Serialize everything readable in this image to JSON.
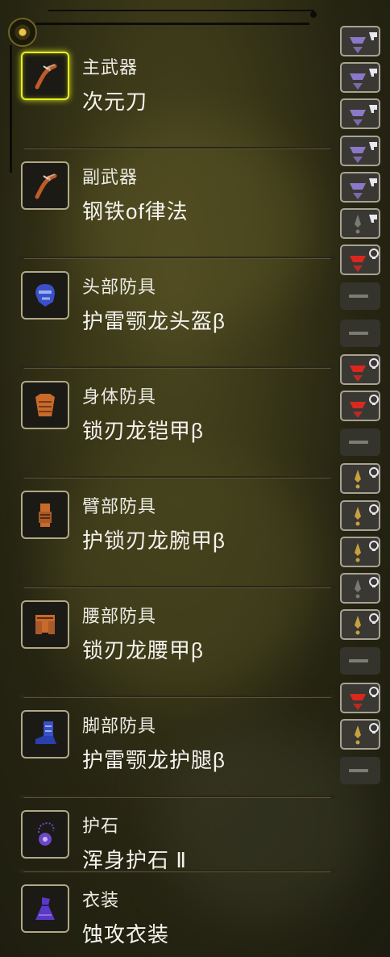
{
  "colors": {
    "selected_border": "#e8f020",
    "text": "#f4f3ee",
    "blade": "#c05a2a",
    "armor_blue": "#3a50c8",
    "armor_orange": "#c86a2a",
    "charm_purple": "#6a48c8",
    "deco_purple": "#8a78c8",
    "deco_red": "#d82820",
    "deco_gold": "#c8a040"
  },
  "slots": [
    {
      "category": "主武器",
      "name": "次元刀",
      "icon": "long-sword-icon",
      "selected": true
    },
    {
      "category": "副武器",
      "name": "钢铁of律法",
      "icon": "long-sword-icon",
      "selected": false
    },
    {
      "category": "头部防具",
      "name": "护雷颚龙头盔β",
      "icon": "helmet-icon",
      "selected": false
    },
    {
      "category": "身体防具",
      "name": "锁刃龙铠甲β",
      "icon": "chest-armor-icon",
      "selected": false
    },
    {
      "category": "臂部防具",
      "name": "护锁刃龙腕甲β",
      "icon": "gauntlet-icon",
      "selected": false
    },
    {
      "category": "腰部防具",
      "name": "锁刃龙腰甲β",
      "icon": "waist-armor-icon",
      "selected": false
    },
    {
      "category": "脚部防具",
      "name": "护雷颚龙护腿β",
      "icon": "leg-armor-icon",
      "selected": false
    },
    {
      "category": "护石",
      "name": "浑身护石 Ⅱ",
      "icon": "charm-icon",
      "selected": false
    },
    {
      "category": "衣装",
      "name": "蚀攻衣装",
      "icon": "layered-armor-icon",
      "selected": false
    }
  ],
  "decorations": [
    {
      "type": "weapon",
      "color": "purple"
    },
    {
      "type": "weapon",
      "color": "purple"
    },
    {
      "type": "weapon",
      "color": "purple"
    },
    {
      "type": "weapon",
      "color": "purple"
    },
    {
      "type": "weapon",
      "color": "purple"
    },
    {
      "type": "weapon",
      "color": "gray"
    },
    {
      "type": "armor",
      "color": "red"
    },
    {
      "type": "empty"
    },
    {
      "type": "empty"
    },
    {
      "type": "armor",
      "color": "red"
    },
    {
      "type": "armor",
      "color": "red"
    },
    {
      "type": "empty"
    },
    {
      "type": "armor",
      "color": "gold"
    },
    {
      "type": "armor",
      "color": "gold"
    },
    {
      "type": "armor",
      "color": "gold"
    },
    {
      "type": "armor",
      "color": "gray"
    },
    {
      "type": "armor",
      "color": "gold"
    },
    {
      "type": "empty"
    },
    {
      "type": "armor",
      "color": "red"
    },
    {
      "type": "armor",
      "color": "gold"
    },
    {
      "type": "empty"
    }
  ]
}
